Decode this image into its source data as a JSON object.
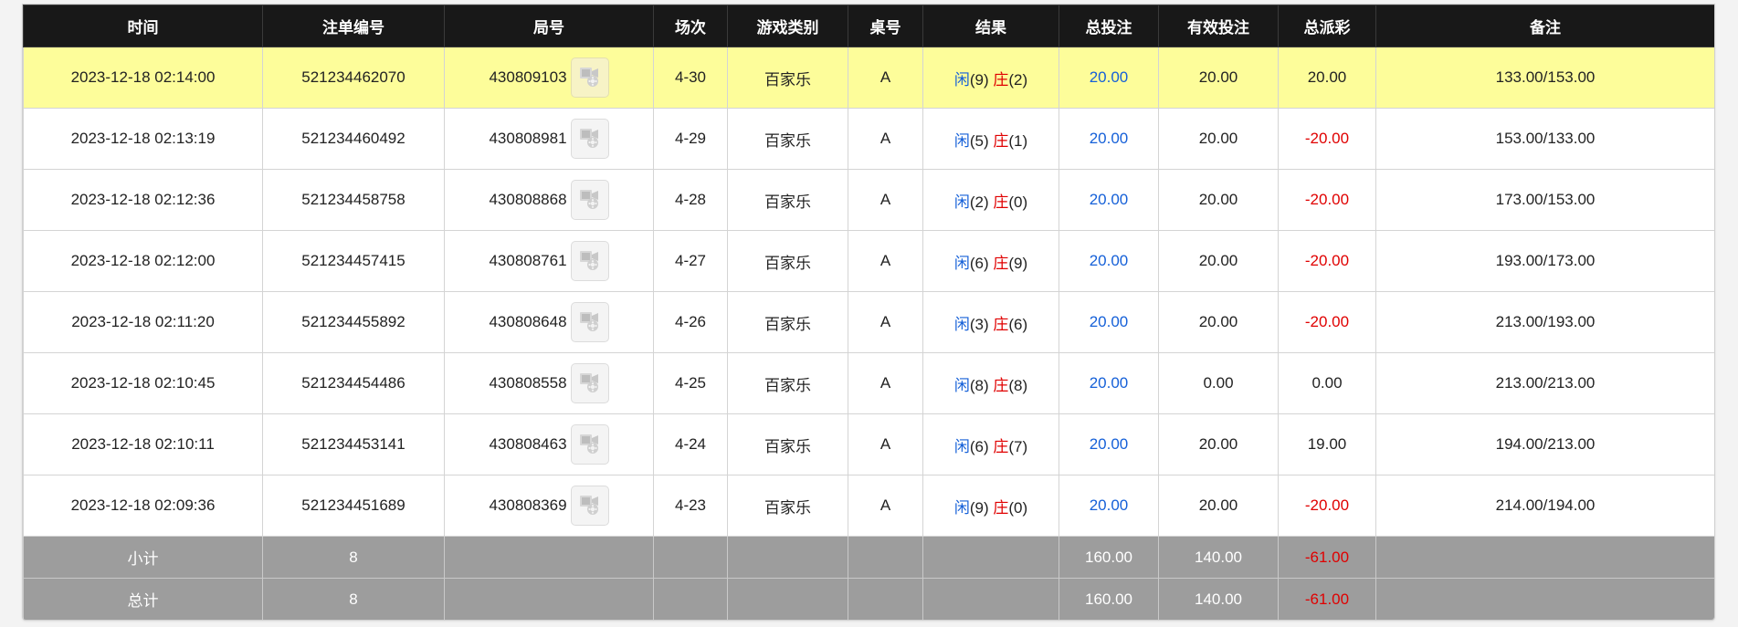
{
  "columns": [
    "时间",
    "注单编号",
    "局号",
    "场次",
    "游戏类别",
    "桌号",
    "结果",
    "总投注",
    "有效投注",
    "总派彩",
    "备注"
  ],
  "rows": [
    {
      "time": "2023-12-18 02:14:00",
      "bet_no": "521234462070",
      "round": "430809103",
      "session": "4-30",
      "game": "百家乐",
      "table": "A",
      "player_label": "闲",
      "player_score": "(9)",
      "banker_label": "庄",
      "banker_score": "(2)",
      "total_bet": "20.00",
      "valid_bet": "20.00",
      "payout": "20.00",
      "payout_neg": false,
      "note": "133.00/153.00",
      "highlight": true
    },
    {
      "time": "2023-12-18 02:13:19",
      "bet_no": "521234460492",
      "round": "430808981",
      "session": "4-29",
      "game": "百家乐",
      "table": "A",
      "player_label": "闲",
      "player_score": "(5)",
      "banker_label": "庄",
      "banker_score": "(1)",
      "total_bet": "20.00",
      "valid_bet": "20.00",
      "payout": "-20.00",
      "payout_neg": true,
      "note": "153.00/133.00",
      "highlight": false
    },
    {
      "time": "2023-12-18 02:12:36",
      "bet_no": "521234458758",
      "round": "430808868",
      "session": "4-28",
      "game": "百家乐",
      "table": "A",
      "player_label": "闲",
      "player_score": "(2)",
      "banker_label": "庄",
      "banker_score": "(0)",
      "total_bet": "20.00",
      "valid_bet": "20.00",
      "payout": "-20.00",
      "payout_neg": true,
      "note": "173.00/153.00",
      "highlight": false
    },
    {
      "time": "2023-12-18 02:12:00",
      "bet_no": "521234457415",
      "round": "430808761",
      "session": "4-27",
      "game": "百家乐",
      "table": "A",
      "player_label": "闲",
      "player_score": "(6)",
      "banker_label": "庄",
      "banker_score": "(9)",
      "total_bet": "20.00",
      "valid_bet": "20.00",
      "payout": "-20.00",
      "payout_neg": true,
      "note": "193.00/173.00",
      "highlight": false
    },
    {
      "time": "2023-12-18 02:11:20",
      "bet_no": "521234455892",
      "round": "430808648",
      "session": "4-26",
      "game": "百家乐",
      "table": "A",
      "player_label": "闲",
      "player_score": "(3)",
      "banker_label": "庄",
      "banker_score": "(6)",
      "total_bet": "20.00",
      "valid_bet": "20.00",
      "payout": "-20.00",
      "payout_neg": true,
      "note": "213.00/193.00",
      "highlight": false
    },
    {
      "time": "2023-12-18 02:10:45",
      "bet_no": "521234454486",
      "round": "430808558",
      "session": "4-25",
      "game": "百家乐",
      "table": "A",
      "player_label": "闲",
      "player_score": "(8)",
      "banker_label": "庄",
      "banker_score": "(8)",
      "total_bet": "20.00",
      "valid_bet": "0.00",
      "payout": "0.00",
      "payout_neg": false,
      "note": "213.00/213.00",
      "highlight": false
    },
    {
      "time": "2023-12-18 02:10:11",
      "bet_no": "521234453141",
      "round": "430808463",
      "session": "4-24",
      "game": "百家乐",
      "table": "A",
      "player_label": "闲",
      "player_score": "(6)",
      "banker_label": "庄",
      "banker_score": "(7)",
      "total_bet": "20.00",
      "valid_bet": "20.00",
      "payout": "19.00",
      "payout_neg": false,
      "note": "194.00/213.00",
      "highlight": false
    },
    {
      "time": "2023-12-18 02:09:36",
      "bet_no": "521234451689",
      "round": "430808369",
      "session": "4-23",
      "game": "百家乐",
      "table": "A",
      "player_label": "闲",
      "player_score": "(9)",
      "banker_label": "庄",
      "banker_score": "(0)",
      "total_bet": "20.00",
      "valid_bet": "20.00",
      "payout": "-20.00",
      "payout_neg": true,
      "note": "214.00/194.00",
      "highlight": false
    }
  ],
  "subtotal": {
    "label": "小计",
    "count": "8",
    "total_bet": "160.00",
    "valid_bet": "140.00",
    "payout": "-61.00"
  },
  "total": {
    "label": "总计",
    "count": "8",
    "total_bet": "160.00",
    "valid_bet": "140.00",
    "payout": "-61.00"
  },
  "icons": {
    "replay": "video-replay-icon"
  },
  "colors": {
    "header_bg": "#181818",
    "highlight_row": "#fdfd9a",
    "summary_bg": "#9d9d9d",
    "positive_blue": "#1560d8",
    "negative_red": "#e00000"
  }
}
